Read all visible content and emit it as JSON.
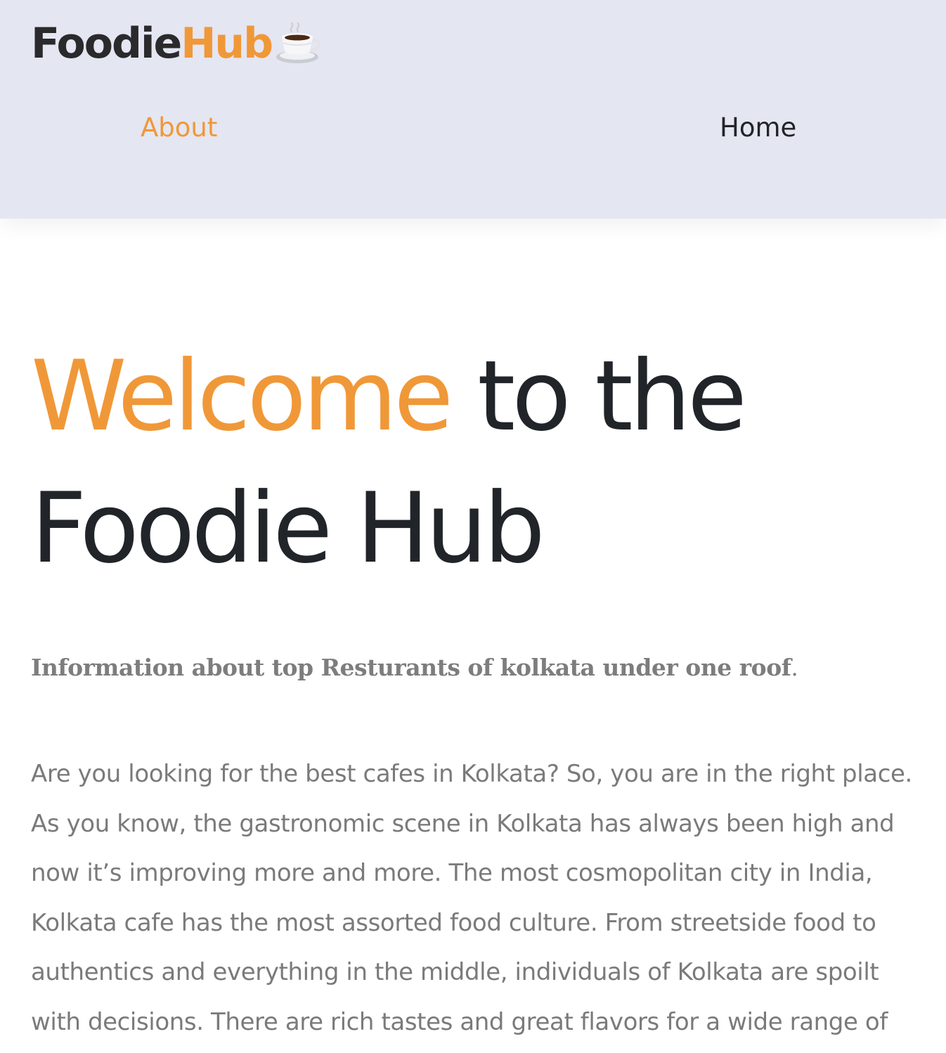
{
  "header": {
    "brand": {
      "part1": "Foodie",
      "part2": "Hub",
      "icon": "hot-beverage-icon"
    },
    "nav": [
      {
        "label": "About",
        "active": true
      },
      {
        "label": "Home",
        "active": false
      }
    ]
  },
  "hero": {
    "title_accent": "Welcome",
    "title_line1_rest": "to the",
    "title_line2": "Foodie Hub"
  },
  "tagline": {
    "text": "Information about top Resturants of kolkata under one roof",
    "punct": "."
  },
  "intro": {
    "lines": [
      "Are you looking for the best cafes in Kolkata? So, you are in the right place.",
      "As you know, the gastronomic scene in Kolkata has always been high and",
      "now it’s improving more and more. The most cosmopolitan city in India,",
      "Kolkata cafe has the most assorted food culture. From streetside food to",
      "authentics and everything in the middle, individuals of Kolkata are spoilt",
      "with decisions. There are rich tastes and great flavors for a wide range of"
    ]
  },
  "colors": {
    "accent": "#f09838",
    "header_bg": "#e4e6f2",
    "text_dark": "#212529",
    "text_muted": "#7a7a7a"
  }
}
